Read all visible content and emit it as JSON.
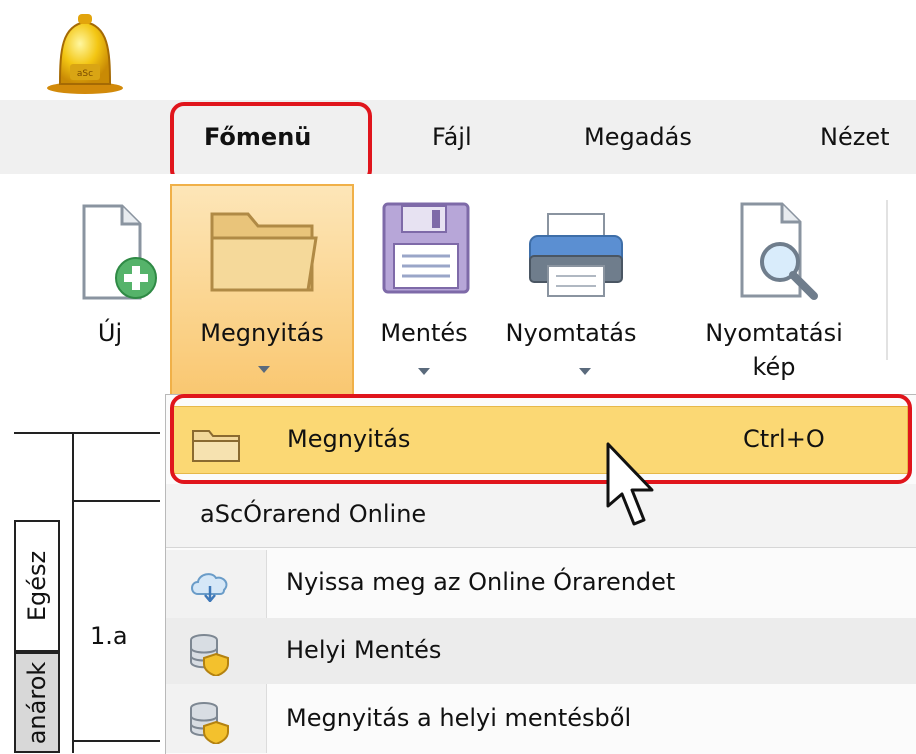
{
  "menubar": {
    "tabs": [
      {
        "label": "Főmenü"
      },
      {
        "label": "Fájl"
      },
      {
        "label": "Megadás"
      },
      {
        "label": "Nézet"
      }
    ]
  },
  "toolbar": {
    "buttons": [
      {
        "label": "Új",
        "has_arrow": false
      },
      {
        "label": "Megnyitás",
        "has_arrow": true
      },
      {
        "label": "Mentés",
        "has_arrow": true
      },
      {
        "label": "Nyomtatás",
        "has_arrow": true
      },
      {
        "label_line1": "Nyomtatási",
        "label_line2": "kép",
        "has_arrow": false
      }
    ]
  },
  "dropdown": {
    "items": [
      {
        "label": "Megnyitás",
        "shortcut": "Ctrl+O",
        "icon": "folder-icon",
        "highlighted": true
      },
      {
        "label": "aScÓrarend Online",
        "type": "header"
      },
      {
        "label": "Nyissa meg az Online Órarendet",
        "icon": "cloud-icon"
      },
      {
        "label": "Helyi Mentés",
        "icon": "database-shield-icon"
      },
      {
        "label": "Megnyitás a helyi mentésből",
        "icon": "database-shield-icon"
      }
    ]
  },
  "left_panel": {
    "tabs": [
      {
        "label": "Egész"
      },
      {
        "label": "anárok"
      }
    ],
    "row_label": "1.a"
  },
  "colors": {
    "highlight_red": "#e0151c",
    "selected_button_bg": "#f9c66e",
    "selected_item_bg": "#fbd874"
  }
}
